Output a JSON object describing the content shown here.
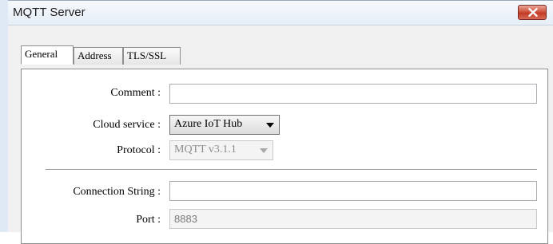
{
  "window": {
    "title": "MQTT Server"
  },
  "tabs": [
    {
      "label": "General",
      "active": true
    },
    {
      "label": "Address",
      "active": false
    },
    {
      "label": "TLS/SSL",
      "active": false
    }
  ],
  "form": {
    "comment_label": "Comment :",
    "comment_value": "",
    "cloud_service_label": "Cloud service :",
    "cloud_service_value": "Azure IoT Hub",
    "protocol_label": "Protocol :",
    "protocol_value": "MQTT v3.1.1",
    "connection_string_label": "Connection String :",
    "connection_string_value": "",
    "port_label": "Port :",
    "port_value": "8883"
  },
  "colors": {
    "close_button": "#c23a24",
    "dialog_background": "#f0f0f0"
  }
}
